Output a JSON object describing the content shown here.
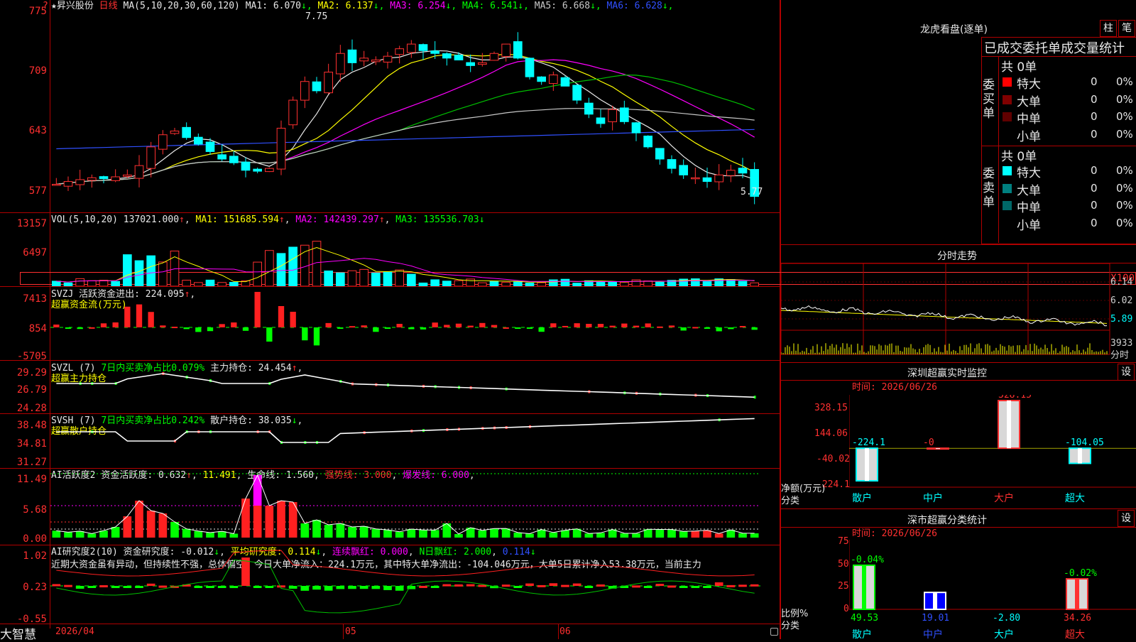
{
  "main_chart": {
    "star": "★",
    "stock_name": "昇兴股份",
    "period": "日线",
    "ma_params": "MA(5,10,20,30,60,120)",
    "ma_values": [
      {
        "label": "MA1: 6.070",
        "arrow": "↓",
        "color": "#e8e8e8"
      },
      {
        "label": "MA2: 6.137",
        "arrow": "↓",
        "color": "#ffff00"
      },
      {
        "label": "MA3: 6.254",
        "arrow": "↓",
        "color": "#ff00ff"
      },
      {
        "label": "MA4: 6.541",
        "arrow": "↓",
        "color": "#00ff00"
      },
      {
        "label": "MA5: 6.668",
        "arrow": "↓",
        "color": "#c8c8c8"
      },
      {
        "label": "MA6: 6.628",
        "arrow": "↓",
        "color": "#3050ff"
      }
    ],
    "y_ticks": [
      "775",
      "709",
      "643",
      "577"
    ],
    "question_mark": "?",
    "high_label": "7.75",
    "low_label": "5.77"
  },
  "vol_panel": {
    "title": "VOL(5,10,20)",
    "value": "137021.000",
    "ma1": "MA1: 151685.594",
    "ma2": "MA2: 142439.297",
    "ma3": "MA3: 135536.703",
    "y_ticks": [
      "13157",
      "6497",
      "X100"
    ]
  },
  "svzj_panel": {
    "title": "SVZJ",
    "label": "活跃资金进出: 224.095",
    "arrow": "↑",
    "subtitle": "超赢资金流(万元)",
    "y_ticks": [
      "7413",
      "854",
      "-5705"
    ]
  },
  "svzl_panel": {
    "title": "SVZL (7)",
    "ratio": "7日内买卖净占比0.079%",
    "holding": "主力持仓: 24.454",
    "arrow": "↑",
    "subtitle": "超赢主力持仓",
    "y_ticks": [
      "29.29",
      "26.79",
      "24.28"
    ]
  },
  "svsh_panel": {
    "title": "SVSH (7)",
    "ratio": "7日内买卖净占比0.242%",
    "holding": "散户持仓: 38.035",
    "arrow": "↓",
    "subtitle": "超赢散户持仓",
    "y_ticks": [
      "38.48",
      "34.81",
      "31.27"
    ]
  },
  "ai_active_panel": {
    "title": "AI活跃度2",
    "active": "资金活跃度: 0.632",
    "v2": "11.491",
    "life": "生命线: 1.560",
    "strong": "强势线: 3.000",
    "burst": "爆发线: 6.000",
    "y_ticks": [
      "11.49",
      "5.68",
      "0.00"
    ]
  },
  "ai_research_panel": {
    "title": "AI研究度2(10)",
    "research": "资金研究度: -0.012",
    "avg": "平均研究度: 0.114",
    "streak": "连续飘红: 0.000",
    "nday": "N日飘红: 2.000",
    "last": "0.114",
    "comment": "近期大资金虽有异动，但持续性不强，总体偏空，今日大单净流入：224.1万元，其中特大单净流出：-104.046万元，大单5日累计净入53.38万元，当前主力",
    "y_ticks": [
      "1.02",
      "0.23",
      "-0.55"
    ]
  },
  "bottom_axis": {
    "brand": "大智慧",
    "start_date": "2026/04",
    "months": [
      "05",
      "06"
    ]
  },
  "dragon_panel": {
    "title": "龙虎看盘(逐单)",
    "btn_bar": "柱",
    "btn_tick": "笔",
    "table_title": "已成交委托单成交量统计",
    "buy_label": "委买单",
    "sell_label": "委卖单",
    "buy_total": "共 0单",
    "sell_total": "共 0单",
    "buy_rows": [
      {
        "name": "特大",
        "count": "0",
        "pct": "0%",
        "color": "#ff0000"
      },
      {
        "name": "大单",
        "count": "0",
        "pct": "0%",
        "color": "#800000"
      },
      {
        "name": "中单",
        "count": "0",
        "pct": "0%",
        "color": "#600000"
      },
      {
        "name": "小单",
        "count": "0",
        "pct": "0%",
        "color": ""
      }
    ],
    "sell_rows": [
      {
        "name": "特大",
        "count": "0",
        "pct": "0%",
        "color": "#00ffff"
      },
      {
        "name": "大单",
        "count": "0",
        "pct": "0%",
        "color": "#008080"
      },
      {
        "name": "中单",
        "count": "0",
        "pct": "0%",
        "color": "#006868"
      },
      {
        "name": "小单",
        "count": "0",
        "pct": "0%",
        "color": ""
      }
    ]
  },
  "intraday_panel": {
    "title": "分时走势",
    "y_ticks": [
      "6.14",
      "6.02",
      "5.89"
    ],
    "vol_tick": "3933",
    "vol_unit": "分时"
  },
  "sz_monitor": {
    "title": "深圳超赢实时监控",
    "btn": "设",
    "time": "时间: 2026/06/26",
    "y_ticks": [
      "328.15",
      "144.06",
      "-40.02",
      "-224.1"
    ],
    "y_unit": "净额(万元)",
    "x_unit": "分类",
    "chart_data": {
      "type": "bar",
      "categories": [
        "散户",
        "中户",
        "大户",
        "超大"
      ],
      "values": [
        -224.1,
        0,
        328.15,
        -104.05
      ],
      "value_labels": [
        "-224.1",
        "-0",
        "328.15",
        "-104.05"
      ],
      "ylim": [
        -224.1,
        328.15
      ]
    }
  },
  "sz_class": {
    "title": "深市超赢分类统计",
    "btn": "设",
    "time": "时间: 2026/06/26",
    "y_ticks": [
      "75",
      "50",
      "25",
      "0"
    ],
    "y_unit": "比例%",
    "x_unit": "分类",
    "chart_data": {
      "type": "bar",
      "categories": [
        "散户",
        "中户",
        "大户",
        "超大"
      ],
      "values": [
        49.53,
        19.01,
        -2.8,
        34.26
      ],
      "value_labels": [
        "49.53",
        "19.01",
        "-2.80",
        "34.26"
      ],
      "change_labels": [
        "-0.04%",
        "",
        "",
        "-0.02%"
      ],
      "ylim": [
        0,
        75
      ]
    }
  }
}
